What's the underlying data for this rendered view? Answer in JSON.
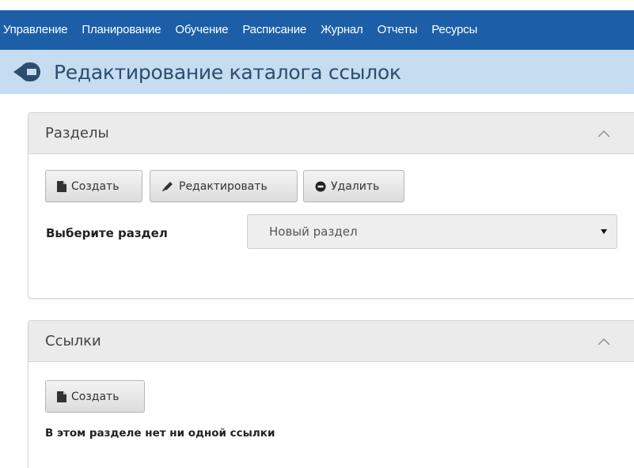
{
  "nav": {
    "items": [
      "Управление",
      "Планирование",
      "Обучение",
      "Расписание",
      "Журнал",
      "Отчеты",
      "Ресурсы"
    ]
  },
  "page": {
    "title": "Редактирование каталога ссылок"
  },
  "sections_panel": {
    "title": "Разделы",
    "create_label": "Создать",
    "edit_label": "Редактировать",
    "delete_label": "Удалить",
    "select_label": "Выберите раздел",
    "select_value": "Новый раздел"
  },
  "links_panel": {
    "title": "Ссылки",
    "create_label": "Создать",
    "empty_message": "В этом разделе нет ни одной ссылки"
  },
  "colors": {
    "navbar": "#1c5fa8",
    "title_bar": "#c6dcf1",
    "title_text": "#2d4d6e",
    "panel_header": "#ebebeb"
  },
  "icons": {
    "back": "arrow-circle-left-icon",
    "collapse": "chevron-up-icon",
    "create": "file-icon",
    "edit": "pencil-icon",
    "delete": "minus-circle-icon",
    "select_caret": "caret-down-icon"
  }
}
